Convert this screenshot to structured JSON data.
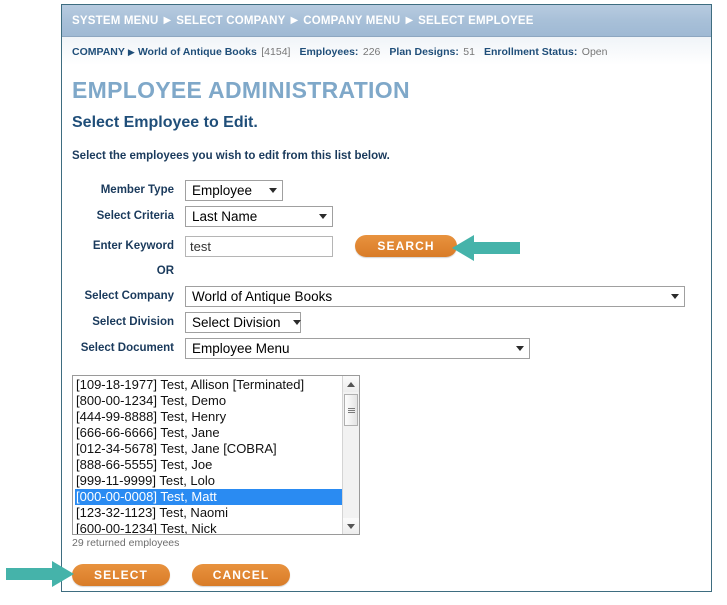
{
  "breadcrumb": {
    "items": [
      "SYSTEM MENU",
      "SELECT COMPANY",
      "COMPANY MENU",
      "SELECT EMPLOYEE"
    ],
    "separator": "▶"
  },
  "company_bar": {
    "company_label": "COMPANY",
    "arrow": "▶",
    "company_name": "World of Antique Books",
    "company_id": "[4154]",
    "employees_label": "Employees:",
    "employees_value": "226",
    "plan_designs_label": "Plan Designs:",
    "plan_designs_value": "51",
    "enrollment_status_label": "Enrollment Status:",
    "enrollment_status_value": "Open"
  },
  "page": {
    "title": "EMPLOYEE ADMINISTRATION",
    "subtitle": "Select Employee to Edit.",
    "instruction": "Select the employees you wish to edit from this list below."
  },
  "form": {
    "member_type": {
      "label": "Member Type",
      "value": "Employee"
    },
    "select_criteria": {
      "label": "Select Criteria",
      "value": "Last Name"
    },
    "enter_keyword": {
      "label": "Enter Keyword",
      "value": "test",
      "placeholder": ""
    },
    "search_button": "SEARCH",
    "or_text": "OR",
    "select_company": {
      "label": "Select Company",
      "value": "World of Antique Books"
    },
    "select_division": {
      "label": "Select Division",
      "value": "Select Division"
    },
    "select_document": {
      "label": "Select Document",
      "value": "Employee Menu"
    }
  },
  "employee_list": {
    "items": [
      {
        "text": "[109-18-1977] Test, Allison [Terminated]",
        "selected": false
      },
      {
        "text": "[800-00-1234] Test, Demo",
        "selected": false
      },
      {
        "text": "[444-99-8888] Test, Henry",
        "selected": false
      },
      {
        "text": "[666-66-6666] Test, Jane",
        "selected": false
      },
      {
        "text": "[012-34-5678] Test, Jane [COBRA]",
        "selected": false
      },
      {
        "text": "[888-66-5555] Test, Joe",
        "selected": false
      },
      {
        "text": "[999-11-9999] Test, Lolo",
        "selected": false
      },
      {
        "text": "[000-00-0008] Test, Matt",
        "selected": true
      },
      {
        "text": "[123-32-1123] Test, Naomi",
        "selected": false
      },
      {
        "text": "[600-00-1234] Test, Nick",
        "selected": false
      }
    ],
    "caption": "29 returned employees"
  },
  "footer": {
    "select_button": "SELECT",
    "cancel_button": "CANCEL"
  },
  "annotations": {
    "arrow_color": "#45b3aa",
    "search_arrow": "left-pointing-arrow",
    "select_arrow": "right-pointing-arrow"
  },
  "colors": {
    "title_blue": "#7fa8c9",
    "heading_navy": "#1f4e79",
    "button_orange": "#df8430",
    "selection_blue": "#2a8bf2",
    "topbar_blue": "#a8c0d8",
    "panel_border": "#3e6d80"
  }
}
